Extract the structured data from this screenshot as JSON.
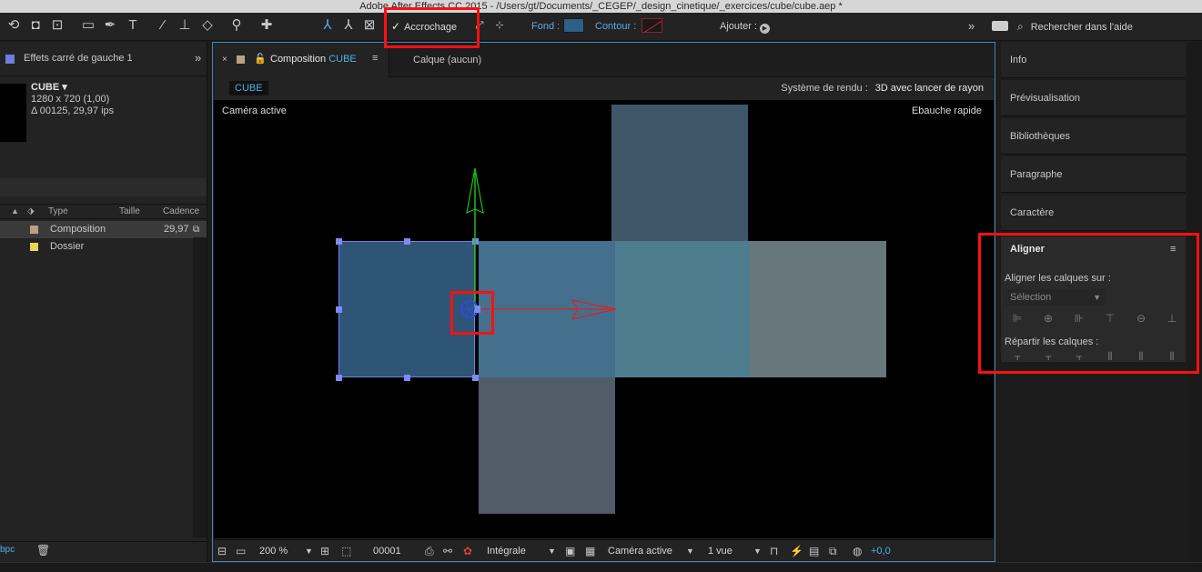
{
  "window": {
    "title": "Adobe After Effects CC 2015 - /Users/gt/Documents/_CEGEP/_design_cinetique/_exercices/cube/cube.aep *"
  },
  "toolbar": {
    "snapping_label": "Accrochage",
    "snapping_check": "✓",
    "fill_label": "Fond :",
    "stroke_label": "Contour :",
    "add_label": "Ajouter :",
    "workspace_chevron": "»",
    "help_search_label": "Rechercher dans l'aide",
    "fill_color": "#2e5f86"
  },
  "effects_panel": {
    "tab_label": "Effets  carré de gauche 1",
    "chevron": "»"
  },
  "project_panel": {
    "comp_name": "CUBE ▾",
    "comp_dims": "1280 x 720 (1,00)",
    "comp_duration": "Δ 00125, 29,97 ips",
    "columns": {
      "type": "Type",
      "size": "Taille",
      "rate": "Cadence"
    },
    "rows": [
      {
        "name": "Composition",
        "rate": "29,97",
        "color": "#b8a380"
      },
      {
        "name": "Dossier",
        "rate": "",
        "color": "#e8d65a"
      }
    ],
    "bpc": "bpc"
  },
  "composition_panel": {
    "tab_close": "×",
    "tab_prefix": "Composition",
    "tab_comp_name": "CUBE",
    "tab_menu": "≡",
    "layer_tab": "Calque  (aucun)",
    "breadcrumb": "CUBE",
    "renderer_label": "Système de rendu :",
    "renderer_value": "3D avec lancer de rayon",
    "camera_label": "Caméra active",
    "quality_label": "Ebauche rapide"
  },
  "comp_footer": {
    "zoom": "200 %",
    "timecode": "00001",
    "resolution": "Intégrale",
    "camera": "Caméra active",
    "views": "1 vue",
    "exposure": "+0,0"
  },
  "right_panels": {
    "items": [
      "Info",
      "Prévisualisation",
      "Bibliothèques",
      "Paragraphe",
      "Caractère"
    ]
  },
  "align_panel": {
    "title": "Aligner",
    "menu": "≡",
    "align_to_label": "Aligner les calques sur :",
    "align_to_value": "Sélection",
    "distribute_label": "Répartir les calques :"
  }
}
